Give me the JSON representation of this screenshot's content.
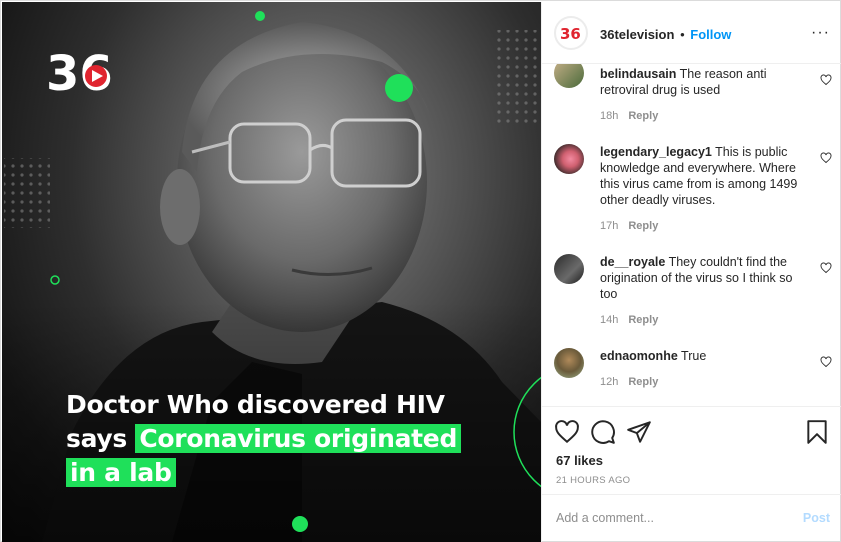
{
  "post": {
    "brand_mark": "36",
    "headline": {
      "line1": "Doctor Who discovered HIV",
      "line2_plain": "says",
      "line2_highlight": "Coronavirus originated",
      "line3_highlight": "in a lab"
    },
    "accent_color": "#1fe05a"
  },
  "header": {
    "username": "36television",
    "separator": "•",
    "follow_label": "Follow",
    "more_label": "···"
  },
  "comments": [
    {
      "username": "belindausain",
      "text": "The reason anti retroviral drug is used",
      "age": "18h",
      "reply_label": "Reply"
    },
    {
      "username": "legendary_legacy1",
      "text": "This is public knowledge and everywhere. Where this virus came from is among 1499 other deadly viruses.",
      "age": "17h",
      "reply_label": "Reply"
    },
    {
      "username": "de__royale",
      "text": "They couldn't find the origination of the virus so I think so too",
      "age": "14h",
      "reply_label": "Reply"
    },
    {
      "username": "ednaomonhe",
      "text": "True",
      "age": "12h",
      "reply_label": "Reply"
    }
  ],
  "actions": {
    "like_icon": "heart-icon",
    "comment_icon": "comment-icon",
    "share_icon": "paper-plane-icon",
    "save_icon": "bookmark-icon",
    "likes_text": "67 likes",
    "timestamp": "21 HOURS AGO"
  },
  "composer": {
    "placeholder": "Add a comment...",
    "post_label": "Post"
  },
  "colors": {
    "link": "#0095f6",
    "muted": "#8e8e8e",
    "post_disabled": "#b3dbff"
  }
}
